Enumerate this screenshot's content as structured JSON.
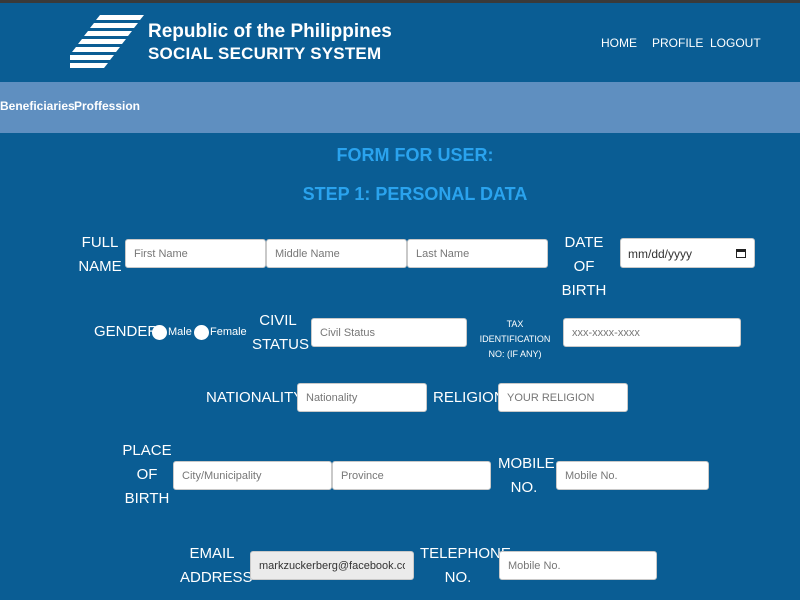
{
  "header": {
    "brand_line1": "Republic of the Philippines",
    "brand_line2": "SOCIAL SECURITY SYSTEM",
    "logo_icon": "sss-logo-icon",
    "nav": [
      "HOME",
      "PROFILE",
      "LOGOUT"
    ]
  },
  "subnav": [
    "Beneficiaries",
    "Proffession"
  ],
  "form": {
    "title": "FORM FOR USER:",
    "step": "STEP 1: PERSONAL DATA",
    "full_name": {
      "label_1": "FULL",
      "label_2": "NAME",
      "first_placeholder": "First Name",
      "middle_placeholder": "Middle Name",
      "last_placeholder": "Last Name"
    },
    "dob": {
      "label_1": "DATE OF",
      "label_2": "BIRTH",
      "value": "mm/dd/yyyy"
    },
    "gender": {
      "label": "GENDER",
      "male": "Male",
      "female": "Female"
    },
    "civil": {
      "label_1": "CIVIL",
      "label_2": "STATUS",
      "placeholder": "Civil Status"
    },
    "tin": {
      "label_1": "TAX IDENTIFICATION",
      "label_2": "NO: (IF ANY)",
      "placeholder": "xxx-xxxx-xxxx"
    },
    "nationality": {
      "label": "NATIONALITY",
      "placeholder": "Nationality"
    },
    "religion": {
      "label": "RELIGION",
      "placeholder": "YOUR RELIGION"
    },
    "pob": {
      "label_1": "PLACE",
      "label_2": "OF",
      "label_3": "BIRTH",
      "city_placeholder": "City/Municipality",
      "province_placeholder": "Province"
    },
    "mobile": {
      "label_1": "MOBILE",
      "label_2": "NO.",
      "placeholder": "Mobile No."
    },
    "email": {
      "label_1": "EMAIL",
      "label_2": "ADDRESS",
      "value": "markzuckerberg@facebook.com"
    },
    "telephone": {
      "label_1": "TELEPHONE",
      "label_2": "NO.",
      "placeholder": "Mobile No."
    }
  },
  "colors": {
    "background": "#0a5d94",
    "subnav": "#5f8fc0",
    "heading": "#2aa3ee"
  }
}
